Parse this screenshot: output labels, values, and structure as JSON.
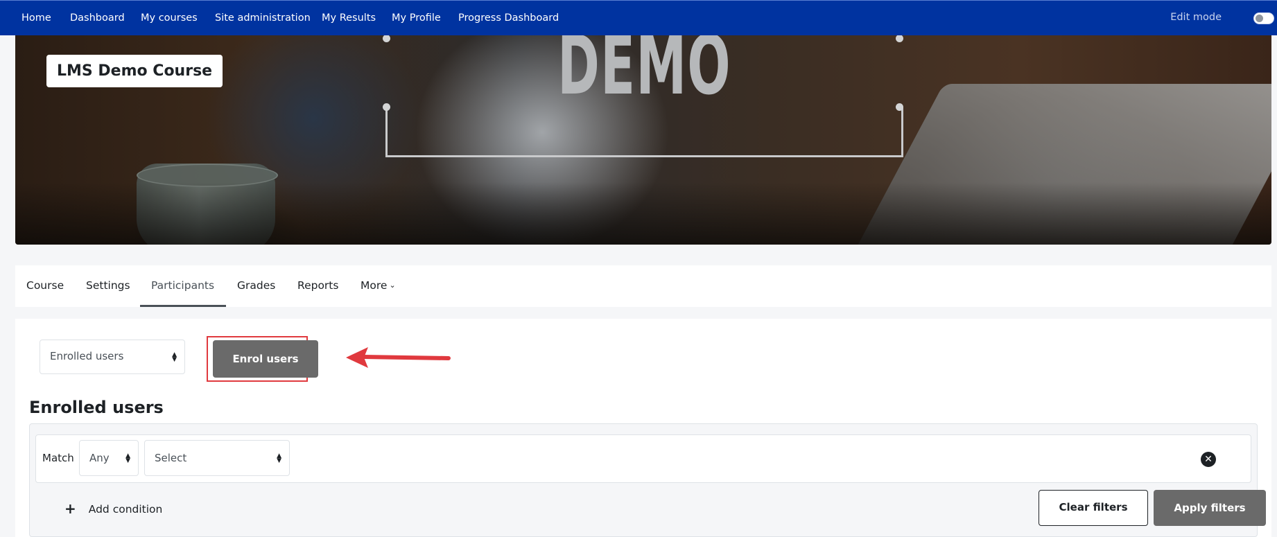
{
  "topnav": {
    "items": [
      "Home",
      "Dashboard",
      "My courses",
      "Site administration",
      "My Results",
      "My Profile",
      "Progress Dashboard"
    ],
    "edit_mode_label": "Edit mode",
    "edit_mode_on": false
  },
  "banner": {
    "demo_text": "DEMO",
    "course_title": "LMS Demo Course"
  },
  "secondary_nav": {
    "tabs": [
      "Course",
      "Settings",
      "Participants",
      "Grades",
      "Reports",
      "More"
    ],
    "active_tab": "Participants"
  },
  "main": {
    "participants_select": "Enrolled users",
    "enrol_button": "Enrol users",
    "section_title": "Enrolled users",
    "filter": {
      "match_label": "Match",
      "match_value": "Any",
      "condition_value": "Select",
      "add_condition": "Add condition",
      "clear_filters": "Clear filters",
      "apply_filters": "Apply filters"
    }
  },
  "colors": {
    "navbar": "#0033a0",
    "highlight": "#e0393e",
    "button_gray": "#6a6a6a"
  }
}
